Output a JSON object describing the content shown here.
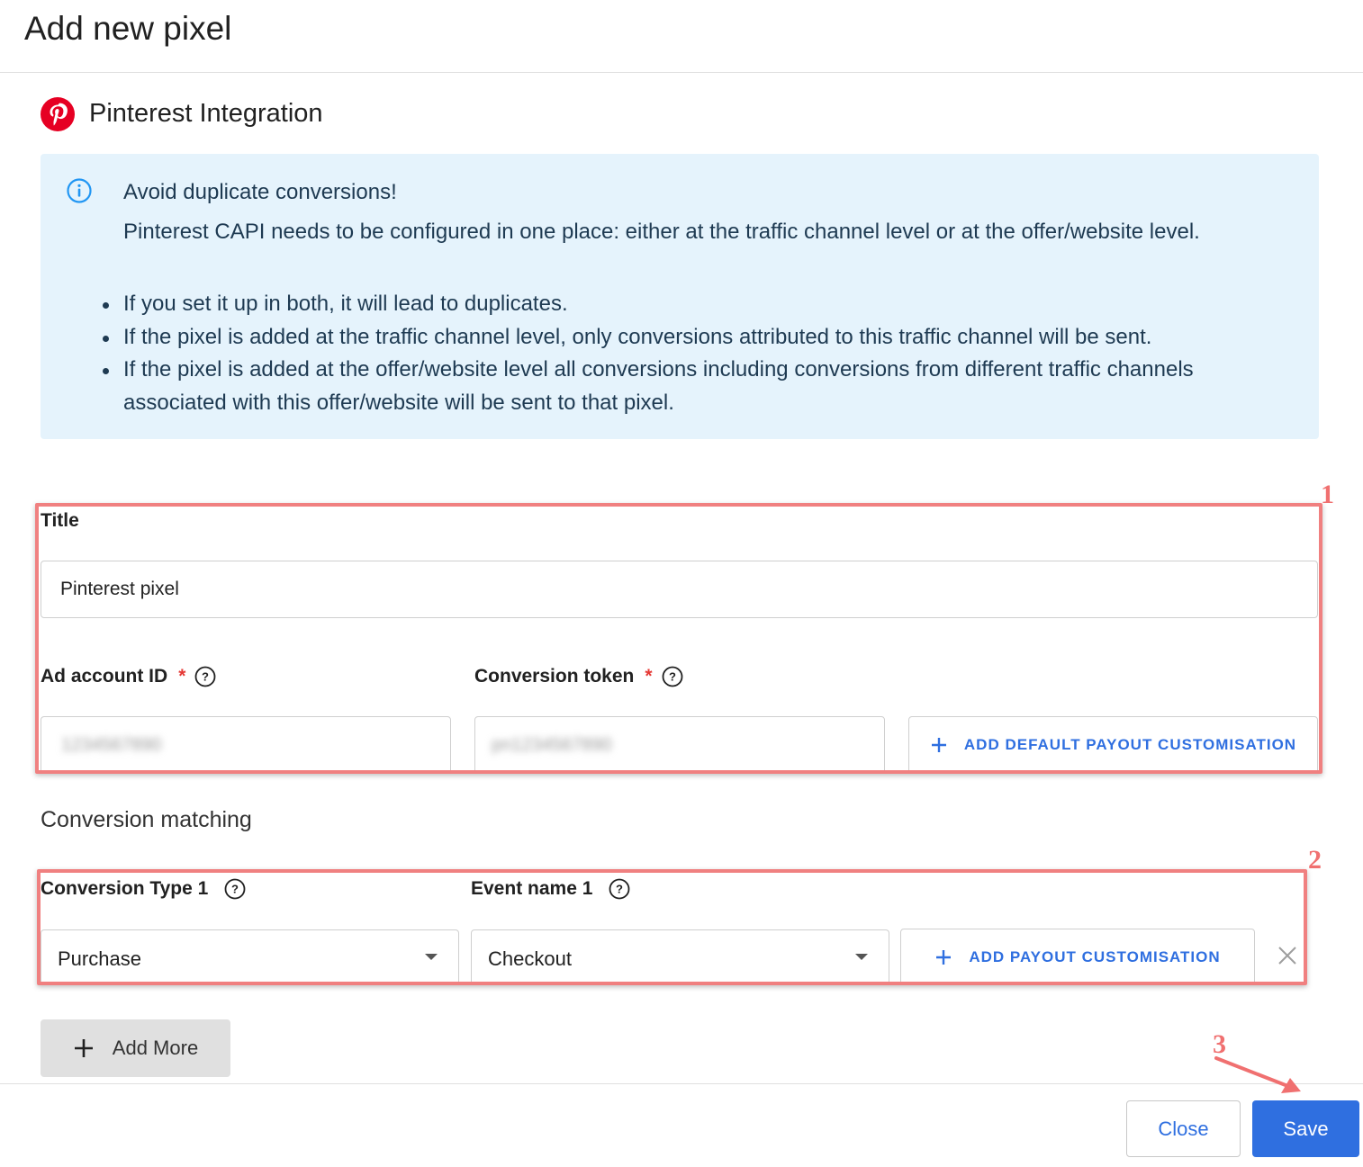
{
  "dialog": {
    "title": "Add new pixel",
    "integration_name": "Pinterest Integration",
    "integration_icon": "pinterest-logo-icon"
  },
  "alert": {
    "heading": "Avoid duplicate conversions!",
    "body": "Pinterest CAPI needs to be configured in one place: either at the traffic channel level or at the offer/website level.",
    "bullets": [
      "If you set it up in both, it will lead to duplicates.",
      "If the pixel is added at the traffic channel level, only conversions attributed to this traffic channel will be sent.",
      "If the pixel is added at the offer/website level all conversions including conversions from different traffic channels associated with this offer/website will be sent to that pixel."
    ]
  },
  "form": {
    "title_label": "Title",
    "title_value": "Pinterest pixel",
    "ad_account_label": "Ad account ID",
    "ad_account_value": "1234567890",
    "conversion_token_label": "Conversion token",
    "conversion_token_value": "pn1234567890",
    "required_mark": "*",
    "add_default_payout_label": "ADD DEFAULT PAYOUT CUSTOMISATION"
  },
  "matching": {
    "heading": "Conversion matching",
    "conversion_type_label": "Conversion Type 1",
    "conversion_type_value": "Purchase",
    "event_name_label": "Event name 1",
    "event_name_value": "Checkout",
    "add_payout_label": "ADD PAYOUT CUSTOMISATION",
    "add_more_label": "Add More"
  },
  "footer": {
    "close_label": "Close",
    "save_label": "Save"
  },
  "annotations": [
    "1",
    "2",
    "3"
  ],
  "colors": {
    "primary": "#2f6fe0",
    "pinterest": "#e60023",
    "alert_bg": "#e5f3fc",
    "annotation": "#f08080",
    "required": "#e53935"
  }
}
